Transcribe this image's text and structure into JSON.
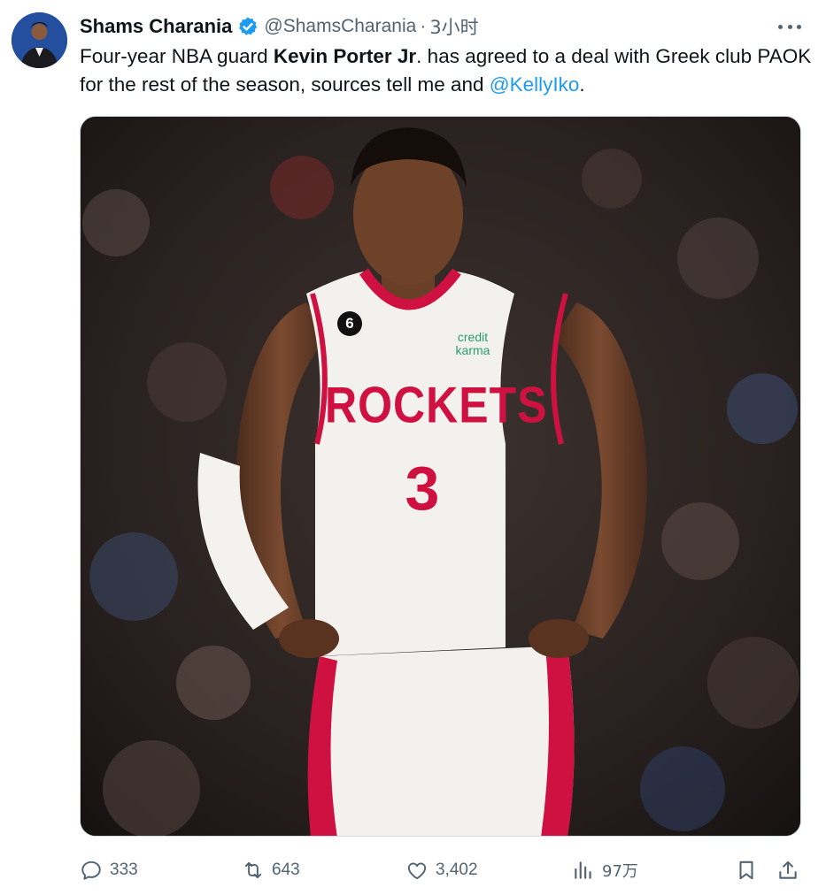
{
  "tweet": {
    "author_name": "Shams Charania",
    "author_handle": "@ShamsCharania",
    "separator": "·",
    "time": "3小时",
    "text_1": "Four-year NBA guard ",
    "text_bold": "Kevin Porter Jr",
    "text_2": ". has agreed to a deal with Greek club PAOK for the rest of the season, sources tell me and ",
    "mention": "@KellyIko",
    "text_3": "."
  },
  "media": {
    "jersey_team": "ROCKETS",
    "jersey_number": "3",
    "sponsor": "credit karma",
    "patch_number": "6"
  },
  "actions": {
    "reply_count": "333",
    "retweet_count": "643",
    "like_count": "3,402",
    "view_count": "97万"
  },
  "icons": {
    "verified": "verified-badge-icon",
    "more": "more-icon",
    "reply": "reply-icon",
    "retweet": "retweet-icon",
    "like": "heart-icon",
    "views": "views-icon",
    "bookmark": "bookmark-icon",
    "share": "share-icon"
  },
  "colors": {
    "accent": "#1d9bf0",
    "text": "#0f1419",
    "muted": "#536471",
    "rockets_red": "#ce1141"
  }
}
